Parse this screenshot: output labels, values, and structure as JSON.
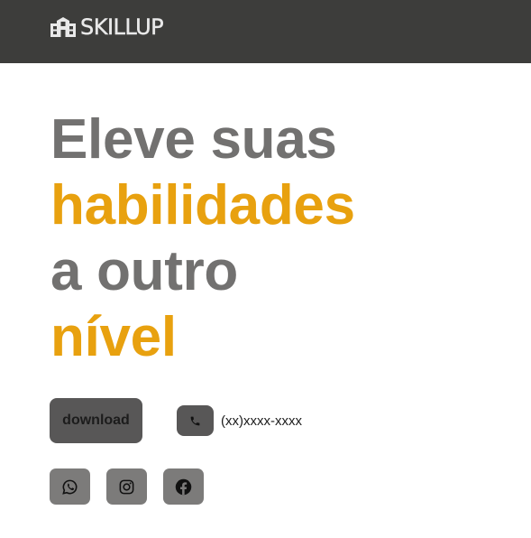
{
  "brand": {
    "name": "SKILLUP",
    "icon": "school-building-icon"
  },
  "hero": {
    "line1": "Eleve suas",
    "line2": "habilidades",
    "line3": "a outro",
    "line4": "nível"
  },
  "actions": {
    "download_label": "download",
    "phone_icon": "phone-icon",
    "phone_number": "(xx)xxxx-xxxx"
  },
  "social": [
    {
      "name": "whatsapp",
      "icon": "whatsapp-icon"
    },
    {
      "name": "instagram",
      "icon": "instagram-icon"
    },
    {
      "name": "facebook",
      "icon": "facebook-icon"
    }
  ],
  "colors": {
    "topbar": "#3d3d3b",
    "heading_grey": "#727170",
    "accent_orange": "#e8a10f",
    "button_dark": "#585757",
    "button_social": "#7c7b7a"
  }
}
